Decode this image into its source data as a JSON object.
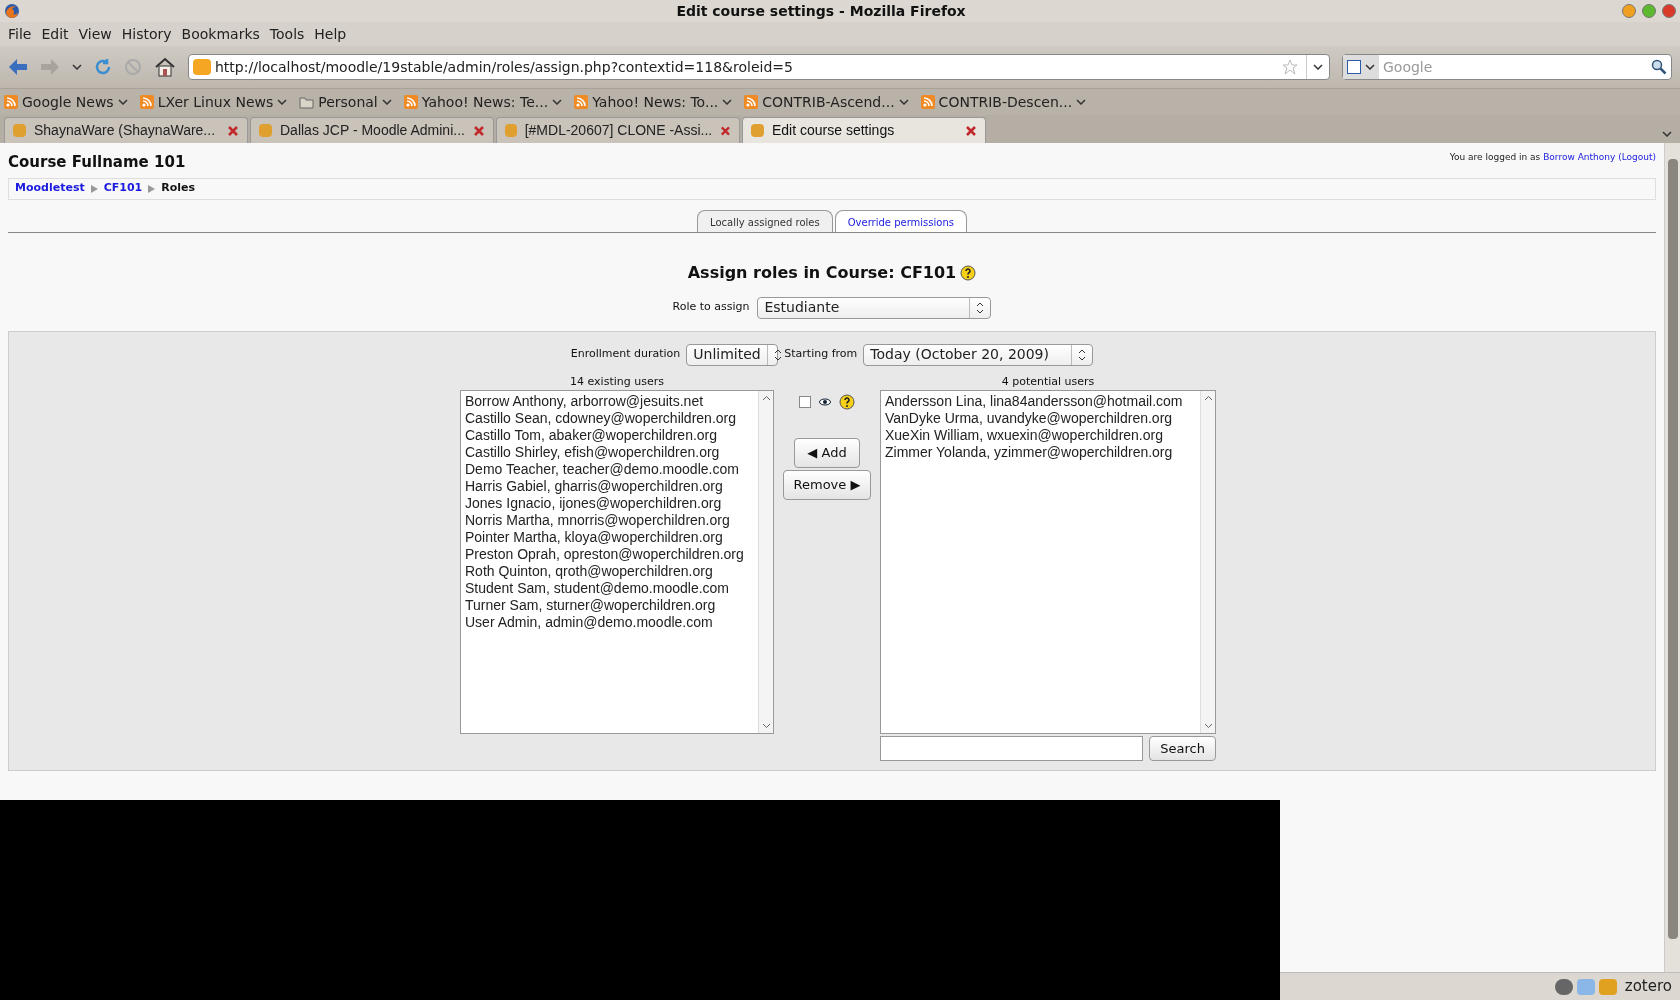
{
  "window": {
    "title": "Edit course settings - Mozilla Firefox"
  },
  "menu": [
    "File",
    "Edit",
    "View",
    "History",
    "Bookmarks",
    "Tools",
    "Help"
  ],
  "address_bar": {
    "value": "http://localhost/moodle/19stable/admin/roles/assign.php?contextid=118&roleid=5"
  },
  "search_bar": {
    "placeholder": "Google"
  },
  "bookmarks": [
    {
      "label": "Google News",
      "kind": "feed"
    },
    {
      "label": "LXer Linux News",
      "kind": "feed"
    },
    {
      "label": "Personal",
      "kind": "folder"
    },
    {
      "label": "Yahoo! News: Te...",
      "kind": "feed"
    },
    {
      "label": "Yahoo! News: To...",
      "kind": "feed"
    },
    {
      "label": "CONTRIB-Ascend...",
      "kind": "feed"
    },
    {
      "label": "CONTRIB-Descen...",
      "kind": "feed"
    }
  ],
  "tabs": [
    {
      "label": "ShaynaWare (ShaynaWare...",
      "selected": false
    },
    {
      "label": "Dallas JCP - Moodle Admini...",
      "selected": false
    },
    {
      "label": "[#MDL-20607] CLONE -Assi...",
      "selected": false
    },
    {
      "label": "Edit course settings",
      "selected": true
    }
  ],
  "page": {
    "course_title": "Course Fullname 101",
    "login": {
      "prefix": "You are logged in as",
      "user": "Borrow Anthony",
      "logout": "(Logout)"
    },
    "breadcrumbs": [
      "Moodletest",
      "CF101",
      "Roles"
    ],
    "page_tabs": [
      {
        "label": "Locally assigned roles",
        "selected": true
      },
      {
        "label": "Override permissions",
        "selected": false
      }
    ],
    "heading": "Assign roles in Course: CF101",
    "role_label": "Role to assign",
    "role_value": "Estudiante",
    "duration_label": "Enrollment duration",
    "duration_value": "Unlimited",
    "start_label": "Starting from",
    "start_value": "Today (October 20, 2009)",
    "existing_title": "14 existing users",
    "existing_users": [
      "Borrow Anthony, arborrow@jesuits.net",
      "Castillo Sean, cdowney@woperchildren.org",
      "Castillo Tom, abaker@woperchildren.org",
      "Castillo Shirley, efish@woperchildren.org",
      "Demo Teacher, teacher@demo.moodle.com",
      "Harris Gabiel, gharris@woperchildren.org",
      "Jones Ignacio, ijones@woperchildren.org",
      "Norris Martha, mnorris@woperchildren.org",
      "Pointer Martha, kloya@woperchildren.org",
      "Preston Oprah, opreston@woperchildren.org",
      "Roth Quinton, qroth@woperchildren.org",
      "Student Sam, student@demo.moodle.com",
      "Turner Sam, sturner@woperchildren.org",
      "User Admin, admin@demo.moodle.com"
    ],
    "show_checkbox": {
      "checked": false
    },
    "add_button": "◀ Add",
    "remove_button": "Remove ▶",
    "potential_title": "4 potential users",
    "potential_users": [
      "Andersson Lina, lina84andersson@hotmail.com",
      "VanDyke Urma, uvandyke@woperchildren.org",
      "XueXin William, wxuexin@woperchildren.org",
      "Zimmer Yolanda, yzimmer@woperchildren.org"
    ],
    "search_button": "Search"
  },
  "status_bar": {
    "zotero": "zotero"
  }
}
